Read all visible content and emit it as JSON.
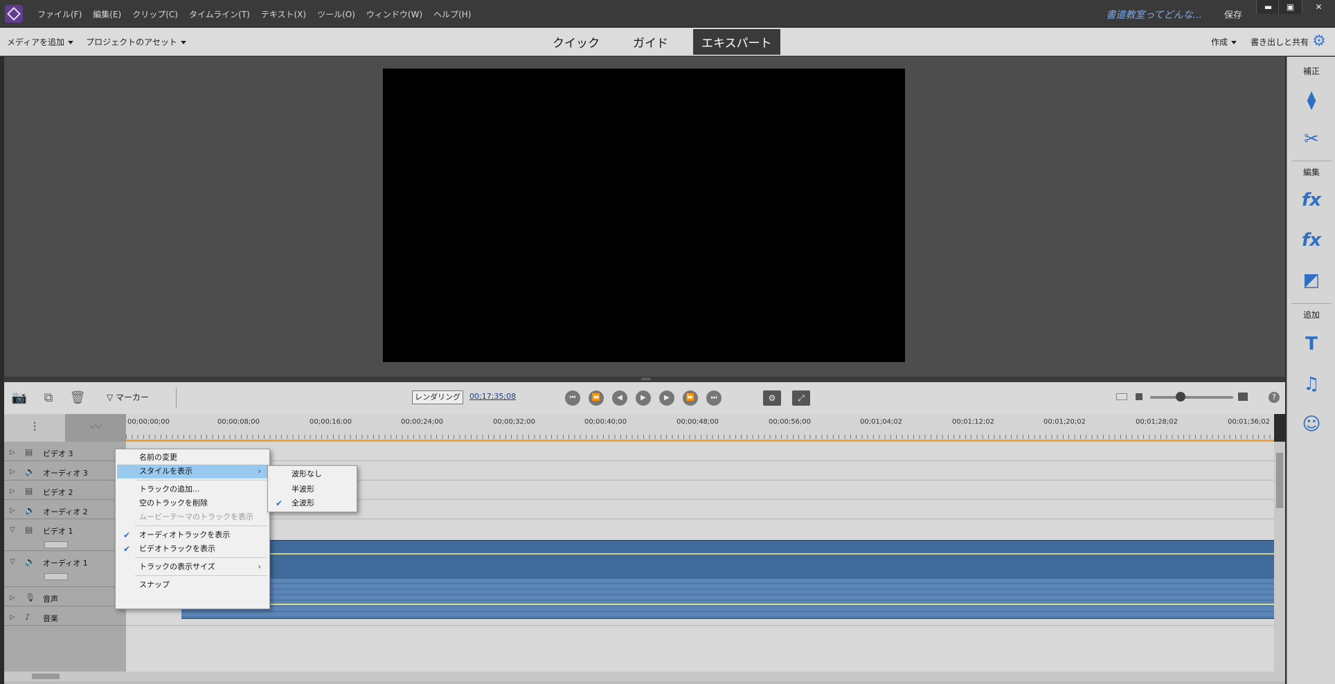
{
  "menubar": {
    "items": [
      "ファイル(F)",
      "編集(E)",
      "クリップ(C)",
      "タイムライン(T)",
      "テキスト(X)",
      "ツール(O)",
      "ウィンドウ(W)",
      "ヘルプ(H)"
    ],
    "project_title": "書道教室ってどんな...",
    "save_label": "保存"
  },
  "modebar": {
    "add_media": "メディアを追加",
    "project_assets": "プロジェクトのアセット",
    "tabs": [
      "クイック",
      "ガイド",
      "エキスパート"
    ],
    "active_tab": "エキスパート",
    "create": "作成",
    "export_share": "書き出しと共有"
  },
  "right_panel": {
    "adjust_heading": "補正",
    "edit_heading": "編集",
    "add_heading": "追加"
  },
  "timeline_toolbar": {
    "marker_label": "マーカー",
    "render_label": "レンダリング",
    "timecode": "00;17;35;08"
  },
  "ruler": {
    "ticks": [
      "00;00;00;00",
      "00;00;08;00",
      "00;00;16;00",
      "00;00;24;00",
      "00;00;32;00",
      "00;00;40;00",
      "00;00;48;00",
      "00;00;56;00",
      "00;01;04;02",
      "00;01;12;02",
      "00;01;20;02",
      "00;01;28;02",
      "00;01;36;02"
    ]
  },
  "tracks": [
    "ビデオ 3",
    "オーディオ 3",
    "ビデオ 2",
    "オーディオ 2",
    "ビデオ 1",
    "オーディオ 1",
    "音声",
    "音楽"
  ],
  "context_menu": {
    "rename": "名前の変更",
    "show_style": "スタイルを表示",
    "add_tracks": "トラックの追加...",
    "delete_empty": "空のトラックを削除",
    "show_movie_theme": "ムービーテーマのトラックを表示",
    "show_audio_tracks": "オーディオトラックを表示",
    "show_video_tracks": "ビデオトラックを表示",
    "track_size": "トラックの表示サイズ",
    "snap": "スナップ"
  },
  "submenu": {
    "no_waveform": "波形なし",
    "half_waveform": "半波形",
    "full_waveform": "全波形",
    "selected": "全波形"
  },
  "colors": {
    "accent": "#3a7bd5",
    "menu_highlight": "#99c9ef",
    "clip_blue": "#3f6a99",
    "playhead_orange": "#f0a030"
  }
}
